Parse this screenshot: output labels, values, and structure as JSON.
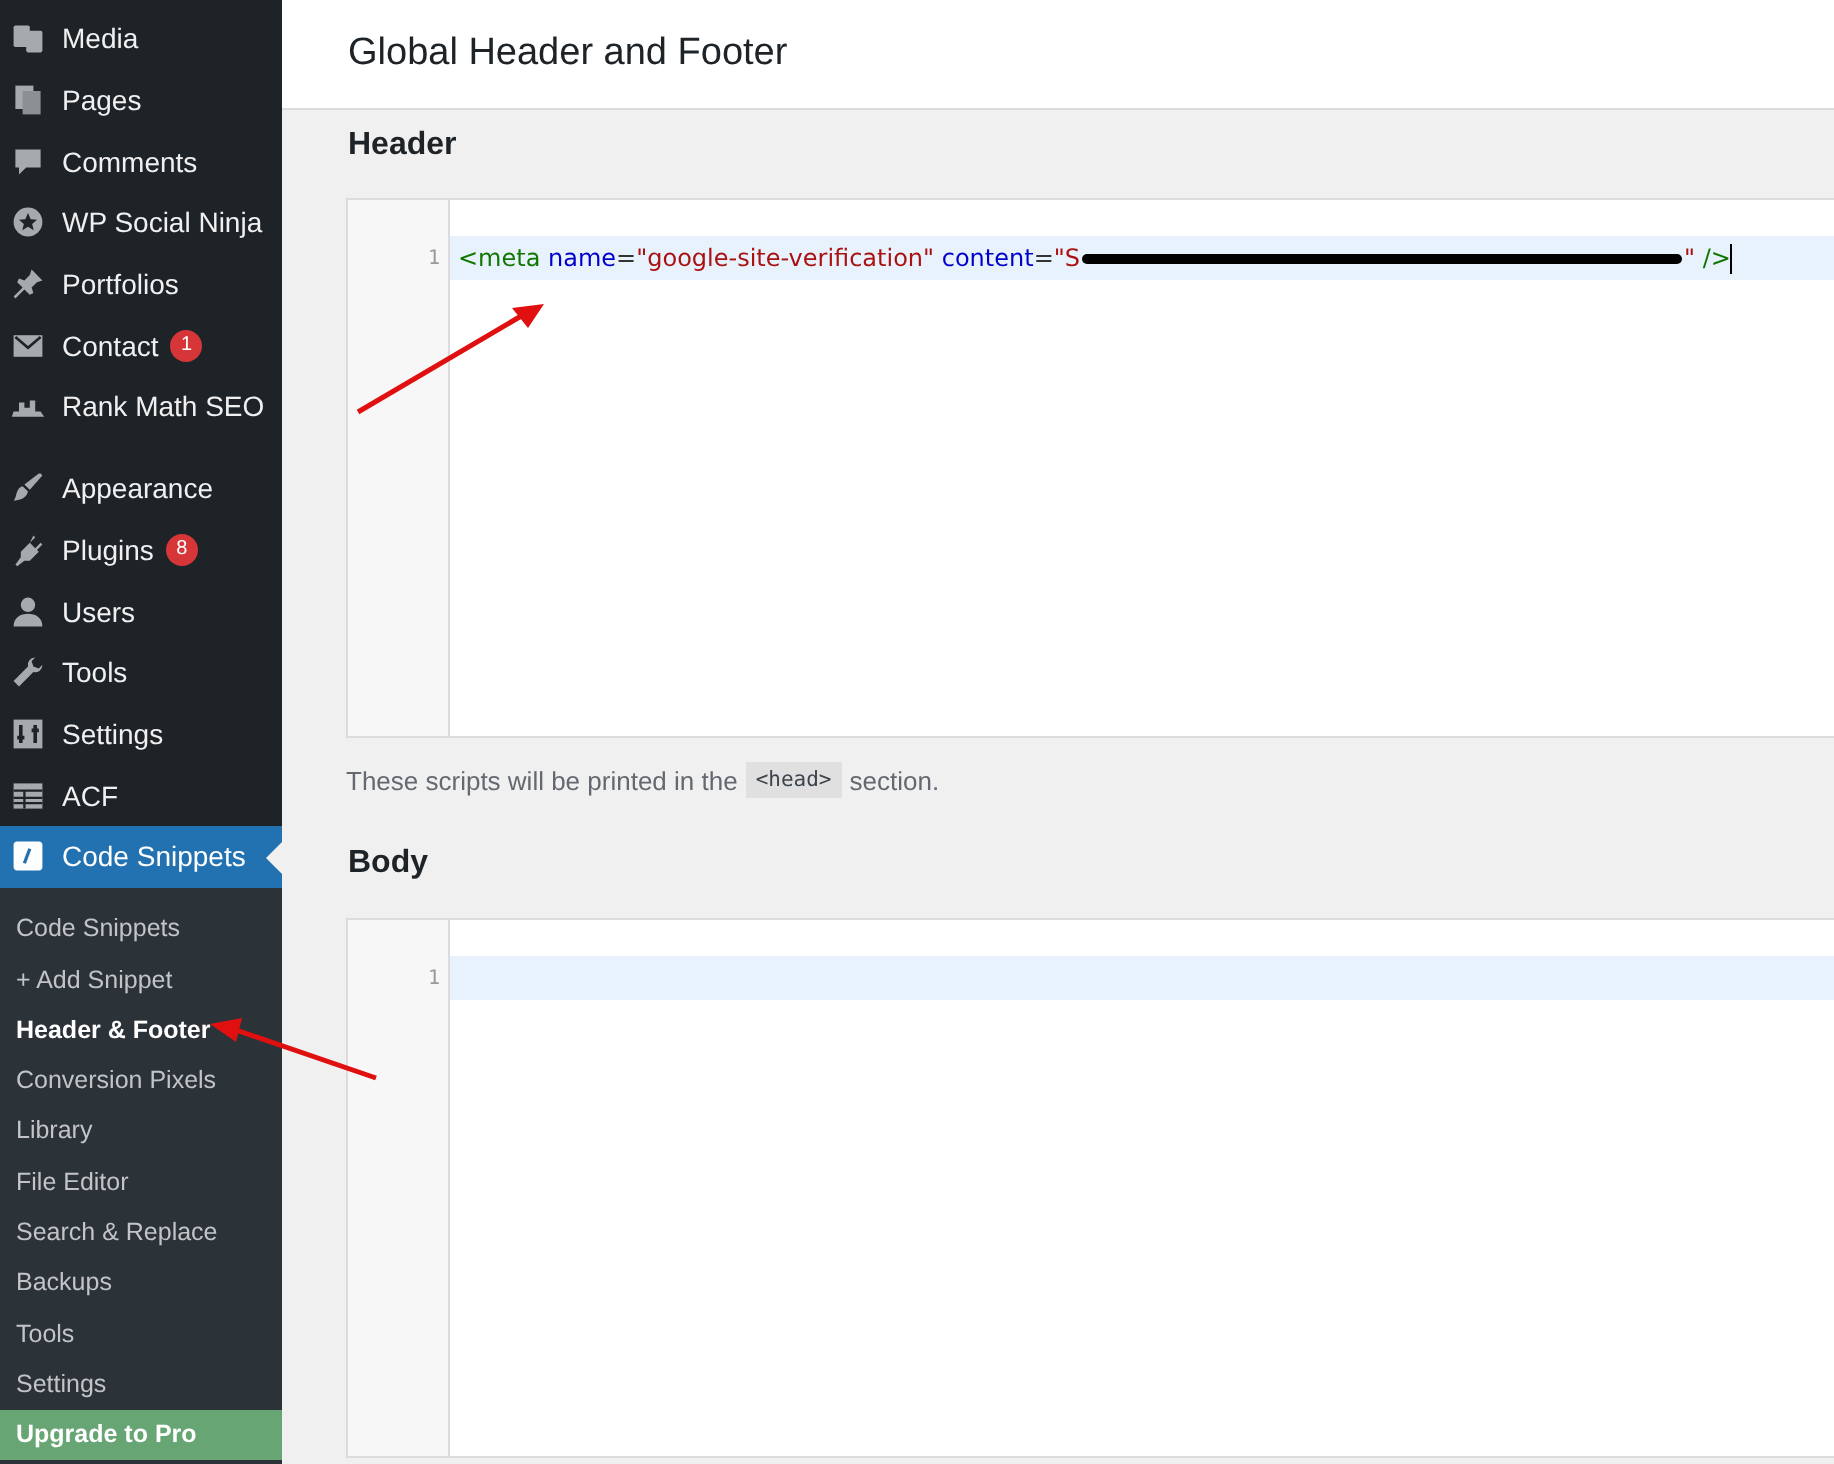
{
  "sidebar": {
    "menu_groups": [
      [
        {
          "label": "Media",
          "selected": false
        },
        {
          "label": "Pages",
          "selected": false
        },
        {
          "label": "Comments",
          "selected": false
        },
        {
          "label": "WP Social Ninja",
          "selected": false
        },
        {
          "label": "Portfolios",
          "selected": false
        },
        {
          "label": "Contact",
          "selected": false,
          "badge": "1"
        },
        {
          "label": "Rank Math SEO",
          "selected": false
        }
      ],
      [
        {
          "label": "Appearance",
          "selected": false
        },
        {
          "label": "Plugins",
          "selected": false,
          "badge": "8"
        },
        {
          "label": "Users",
          "selected": false
        },
        {
          "label": "Tools",
          "selected": false
        },
        {
          "label": "Settings",
          "selected": false
        },
        {
          "label": "ACF",
          "selected": false
        },
        {
          "label": "Code Snippets",
          "selected": true
        }
      ]
    ],
    "submenu": [
      {
        "label": "Code Snippets",
        "kind": "link",
        "selected": false
      },
      {
        "label": "+ Add Snippet",
        "kind": "link",
        "selected": false
      },
      {
        "label": "Header & Footer",
        "kind": "link",
        "selected": true
      },
      {
        "label": "Conversion Pixels",
        "kind": "link",
        "selected": false
      },
      {
        "label": "Library",
        "kind": "link",
        "selected": false
      },
      {
        "label": "File Editor",
        "kind": "link",
        "selected": false
      },
      {
        "label": "Search & Replace",
        "kind": "link",
        "selected": false
      },
      {
        "label": "Backups",
        "kind": "link",
        "selected": false
      },
      {
        "label": "Tools",
        "kind": "link",
        "selected": false
      },
      {
        "label": "Settings",
        "kind": "link",
        "selected": false
      },
      {
        "label": "Upgrade to Pro",
        "kind": "upgrade"
      }
    ]
  },
  "page": {
    "title": "Global Header and Footer",
    "sections": [
      {
        "heading": "Header",
        "editor": {
          "lines": [
            {
              "number": "1",
              "active": true,
              "tokens": [
                {
                  "kind": "tag",
                  "text": "<meta"
                },
                {
                  "kind": "attr",
                  "text": " name"
                },
                {
                  "kind": "punct",
                  "text": "="
                },
                {
                  "kind": "string",
                  "text": "\"google-site-verification\""
                },
                {
                  "kind": "attr",
                  "text": " content"
                },
                {
                  "kind": "punct",
                  "text": "="
                },
                {
                  "kind": "string",
                  "text": "\"S"
                },
                {
                  "kind": "redacted"
                },
                {
                  "kind": "string",
                  "text": "\""
                },
                {
                  "kind": "tag",
                  "text": " />"
                }
              ]
            }
          ]
        },
        "help": {
          "before": "These scripts will be printed in the",
          "code": "<head>",
          "after": "section."
        }
      },
      {
        "heading": "Body",
        "editor": {
          "lines": [
            {
              "number": "1",
              "active": true
            }
          ]
        }
      }
    ]
  }
}
